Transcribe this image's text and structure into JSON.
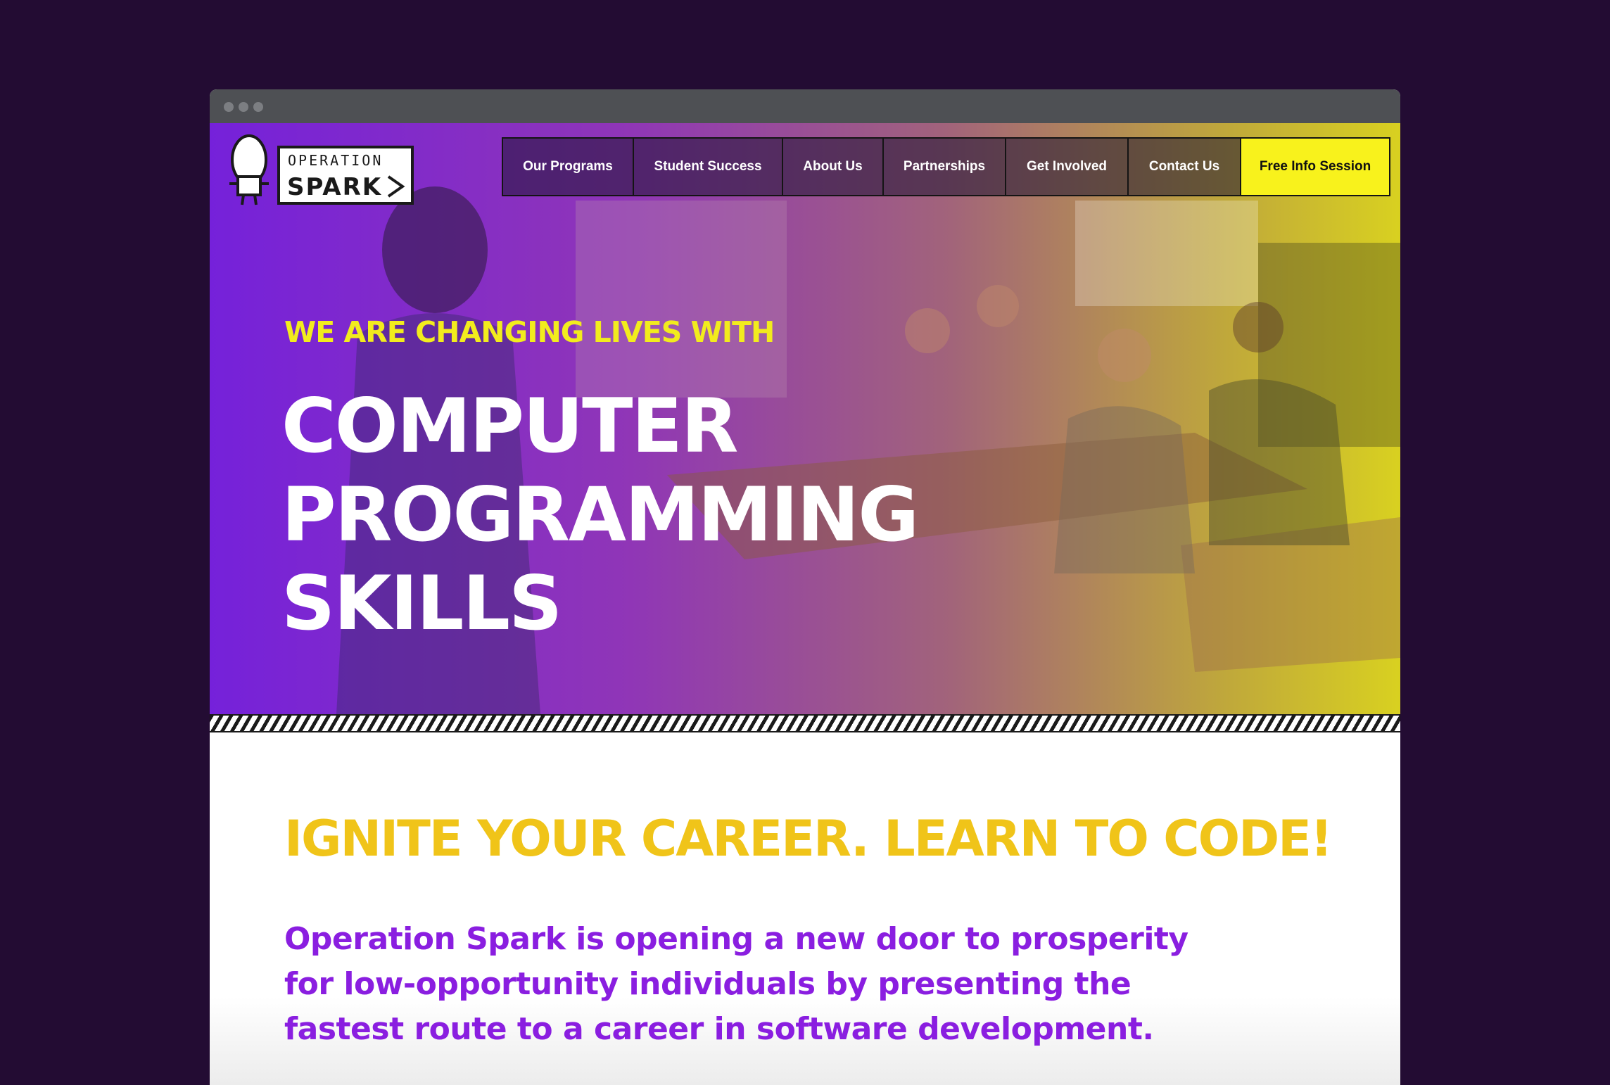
{
  "window": {
    "dots": [
      "red",
      "yellow",
      "green"
    ]
  },
  "logo": {
    "line1": "OPERATION",
    "line2": "SPARK",
    "icon": "robot-mascot-icon"
  },
  "nav": {
    "items": [
      "Our Programs",
      "Student Success",
      "About Us",
      "Partnerships",
      "Get Involved",
      "Contact Us"
    ],
    "cta": "Free Info Session"
  },
  "hero": {
    "eyebrow": "WE ARE CHANGING LIVES WITH",
    "headline": [
      "COMPUTER",
      "PROGRAMMING",
      "SKILLS"
    ]
  },
  "content": {
    "heading": "IGNITE YOUR CAREER. LEARN TO CODE!",
    "body": "Operation Spark is opening a new door to prosperity for low-opportunity individuals by presenting the fastest route to a career in software development."
  },
  "colors": {
    "page_bg": "#230c33",
    "accent_yellow": "#f8f21c",
    "heading_gold": "#f0c419",
    "body_purple": "#8a1ee0"
  }
}
